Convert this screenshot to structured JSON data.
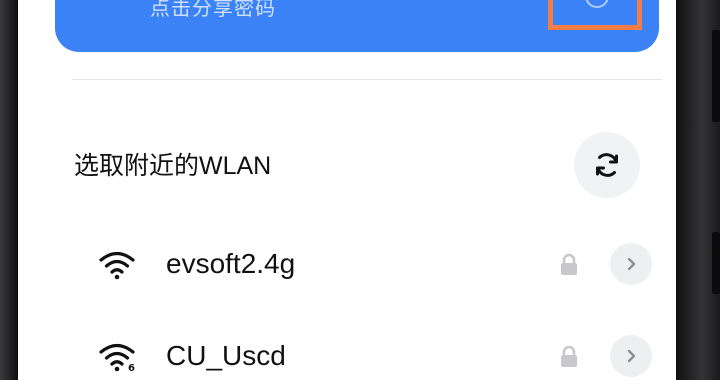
{
  "share_card": {
    "hint": "点击分享密码",
    "color": "#3b82f6"
  },
  "nearby": {
    "title": "选取附近的WLAN",
    "refresh_icon": "refresh-icon"
  },
  "networks": [
    {
      "ssid": "evsoft2.4g",
      "signal_icon": "wifi-icon",
      "secured": true
    },
    {
      "ssid": "CU_Uscd",
      "signal_icon": "wifi-6-icon",
      "secured": true
    }
  ],
  "highlight_color": "#f47c46"
}
